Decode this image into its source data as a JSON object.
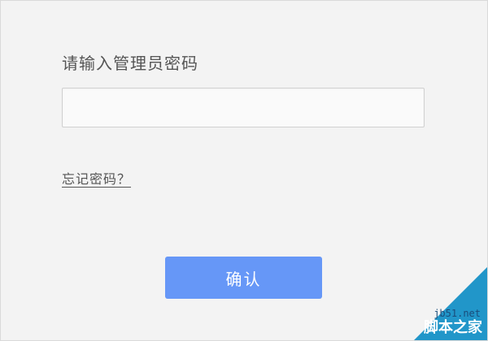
{
  "dialog": {
    "title": "请输入管理员密码",
    "password_value": "",
    "password_placeholder": "",
    "forgot_label": "忘记密码？",
    "confirm_label": "确认"
  },
  "watermark": {
    "site": "jb51.net",
    "brand": "脚本之家"
  },
  "colors": {
    "background": "#f3f3f3",
    "confirm_button": "#6697f7",
    "text": "#555555",
    "watermark_accent": "#2196c9"
  }
}
